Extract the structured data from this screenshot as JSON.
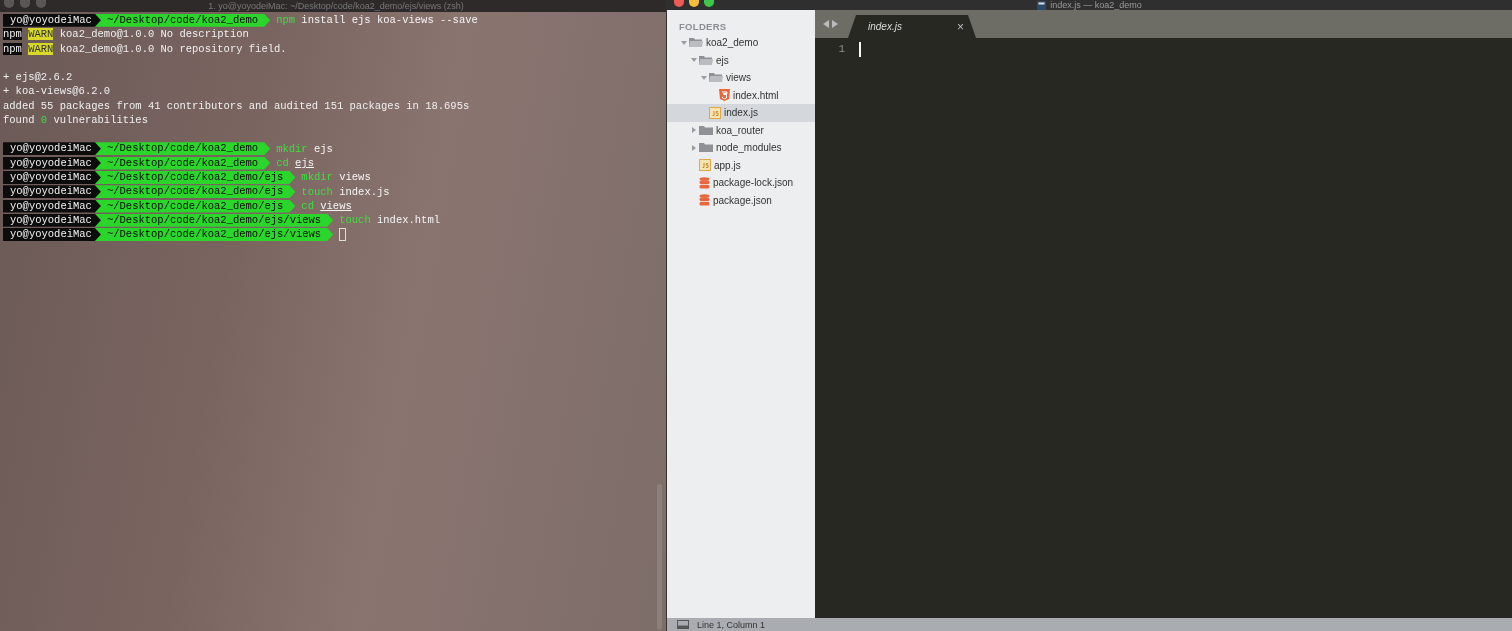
{
  "terminal": {
    "title": "1. yo@yoyodeiMac: ~/Desktop/code/koa2_demo/ejs/views (zsh)",
    "lines": [
      {
        "kind": "prompt",
        "user": "yo@yoyodeiMac",
        "path": "~/Desktop/code/koa2_demo",
        "command": "npm",
        "args": "install ejs koa-views --save",
        "underlined": false,
        "cursor": false
      },
      {
        "kind": "output",
        "segments": [
          {
            "text": "npm",
            "kind": "badge"
          },
          {
            "text": "WARN",
            "kind": "warn"
          },
          {
            "text": "koa2_demo@1.0.0 No description",
            "kind": "plain"
          }
        ]
      },
      {
        "kind": "output",
        "segments": [
          {
            "text": "npm",
            "kind": "badge"
          },
          {
            "text": "WARN",
            "kind": "warn"
          },
          {
            "text": "koa2_demo@1.0.0 No repository field.",
            "kind": "plain"
          }
        ]
      },
      {
        "kind": "blank"
      },
      {
        "kind": "output",
        "segments": [
          {
            "text": "+ ejs@2.6.2",
            "kind": "plain"
          }
        ]
      },
      {
        "kind": "output",
        "segments": [
          {
            "text": "+ koa-views@6.2.0",
            "kind": "plain"
          }
        ]
      },
      {
        "kind": "output",
        "segments": [
          {
            "text": "added 55 packages from 41 contributors and audited 151 packages in 18.695s",
            "kind": "plain"
          }
        ]
      },
      {
        "kind": "output",
        "segments": [
          {
            "text": "found",
            "kind": "plain"
          },
          {
            "text": "0",
            "kind": "success"
          },
          {
            "text": "vulnerabilities",
            "kind": "plain"
          }
        ]
      },
      {
        "kind": "blank"
      },
      {
        "kind": "prompt",
        "user": "yo@yoyodeiMac",
        "path": "~/Desktop/code/koa2_demo",
        "command": "mkdir",
        "args": "ejs",
        "underlined": false,
        "cursor": false
      },
      {
        "kind": "prompt",
        "user": "yo@yoyodeiMac",
        "path": "~/Desktop/code/koa2_demo",
        "command": "cd",
        "args": "ejs",
        "underlined": true,
        "cursor": false
      },
      {
        "kind": "prompt",
        "user": "yo@yoyodeiMac",
        "path": "~/Desktop/code/koa2_demo/ejs",
        "command": "mkdir",
        "args": "views",
        "underlined": false,
        "cursor": false
      },
      {
        "kind": "prompt",
        "user": "yo@yoyodeiMac",
        "path": "~/Desktop/code/koa2_demo/ejs",
        "command": "touch",
        "args": "index.js",
        "underlined": false,
        "cursor": false
      },
      {
        "kind": "prompt",
        "user": "yo@yoyodeiMac",
        "path": "~/Desktop/code/koa2_demo/ejs",
        "command": "cd",
        "args": "views",
        "underlined": true,
        "cursor": false
      },
      {
        "kind": "prompt",
        "user": "yo@yoyodeiMac",
        "path": "~/Desktop/code/koa2_demo/ejs/views",
        "command": "touch",
        "args": "index.html",
        "underlined": false,
        "cursor": false
      },
      {
        "kind": "prompt",
        "user": "yo@yoyodeiMac",
        "path": "~/Desktop/code/koa2_demo/ejs/views",
        "cursor": true
      }
    ]
  },
  "editor": {
    "title": "index.js — koa2_demo",
    "sidebar": {
      "heading": "FOLDERS",
      "tree": [
        {
          "name": "koa2_demo",
          "kind": "folder",
          "expanded": true,
          "selected": false,
          "children": [
            {
              "name": "ejs",
              "kind": "folder",
              "expanded": true,
              "selected": false,
              "children": [
                {
                  "name": "views",
                  "kind": "folder",
                  "expanded": true,
                  "selected": false,
                  "children": [
                    {
                      "name": "index.html",
                      "kind": "html",
                      "selected": false
                    }
                  ]
                },
                {
                  "name": "index.js",
                  "kind": "js",
                  "selected": true
                }
              ]
            },
            {
              "name": "koa_router",
              "kind": "folder",
              "expanded": false,
              "selected": false
            },
            {
              "name": "node_modules",
              "kind": "folder",
              "expanded": false,
              "selected": false
            },
            {
              "name": "app.js",
              "kind": "js",
              "selected": false
            },
            {
              "name": "package-lock.json",
              "kind": "json",
              "selected": false
            },
            {
              "name": "package.json",
              "kind": "json",
              "selected": false
            }
          ]
        }
      ]
    },
    "tabs": [
      {
        "label": "index.js",
        "close": "×",
        "selected": true
      }
    ],
    "gutter": [
      "1"
    ],
    "status": "Line 1, Column 1"
  }
}
